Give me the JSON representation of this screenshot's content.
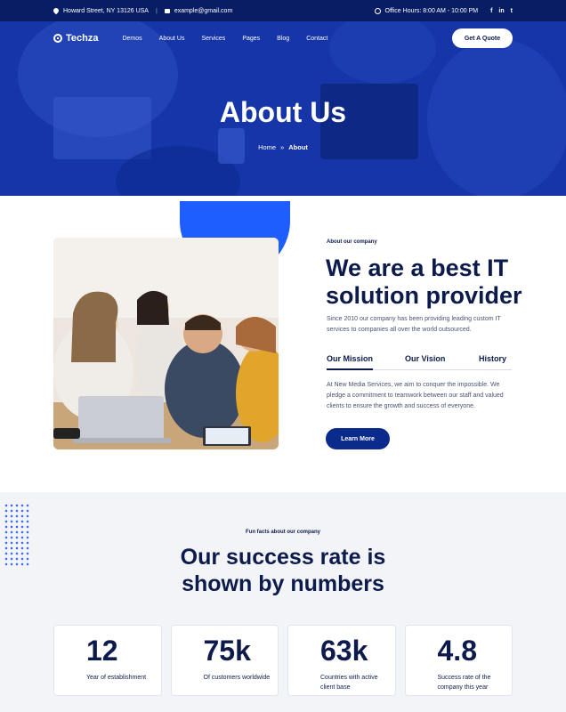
{
  "topbar": {
    "address": "Howard Street, NY 13126 USA",
    "email": "example@gmail.com",
    "hours": "Office Hours: 8:00 AM - 10:00 PM",
    "socials": [
      "f",
      "in",
      "t"
    ]
  },
  "nav": {
    "logo": "Techza",
    "items": [
      "Demos",
      "About Us",
      "Services",
      "Pages",
      "Blog",
      "Contact"
    ],
    "cta": "Get A Quote"
  },
  "hero": {
    "title": "About Us",
    "breadcrumb_home": "Home",
    "breadcrumb_sep": "»",
    "breadcrumb_current": "About"
  },
  "about": {
    "label": "About our company",
    "title": "We are a best IT solution provider",
    "description": "Since 2010 our company has been providing leading custom IT services to companies all over the world outsourced.",
    "tabs": [
      "Our Mission",
      "Our Vision",
      "History"
    ],
    "tab_body": "At New Media Services, we aim to conquer the impossible. We pledge a commitment to teamwork between our staff and valued clients to ensure the growth and success of everyone.",
    "button": "Learn More"
  },
  "stats": {
    "label": "Fun facts about our company",
    "title": "Our success rate is shown by numbers",
    "cards": [
      {
        "value": "12",
        "caption": "Year of establishment"
      },
      {
        "value": "75k",
        "caption": "Of customers worldwide"
      },
      {
        "value": "63k",
        "caption": "Countries with active client base"
      },
      {
        "value": "4.8",
        "caption": "Success rate of the company this year"
      }
    ]
  },
  "colors": {
    "navy": "#081d64",
    "hero_blue": "#12309a",
    "accent_blue": "#1e5eff",
    "button_blue": "#0a2a8c"
  }
}
